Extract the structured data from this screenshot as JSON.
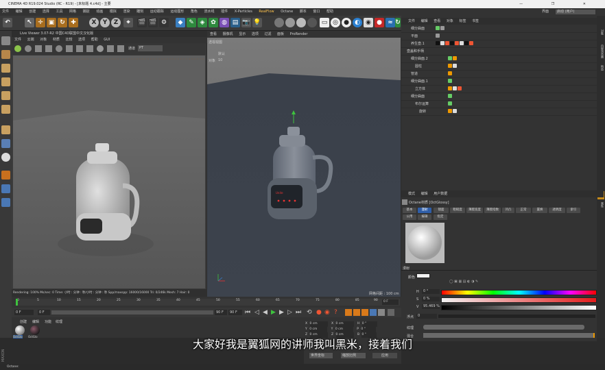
{
  "window": {
    "title": "CINEMA 4D R19.024 Studio (RC - R19) - [未标题 4.c4d] - 主要",
    "controls": [
      "—",
      "❐",
      "✕"
    ]
  },
  "menubar": {
    "items": [
      "文件",
      "编辑",
      "创建",
      "选择",
      "工具",
      "网格",
      "捕捉",
      "动画",
      "模拟",
      "渲染",
      "雕刻",
      "运动跟踪",
      "运动图形",
      "角色",
      "流水线",
      "插件",
      "X-Particles",
      "RealFlow",
      "Octane",
      "脚本",
      "窗口",
      "帮助"
    ],
    "layout_label": "界面",
    "layout_value": "启动 (用户)"
  },
  "live_viewer": {
    "title": "Live Viewer 3.07-R2 中国C4D联盟中文汉化版",
    "menu": [
      "文件",
      "云端",
      "对象",
      "材质",
      "比较",
      "选项",
      "帮助",
      "GUI"
    ],
    "tools_label": "通道",
    "channel_value": "PT",
    "status": "Rendering: 100%    Ms/sec: 0    Time: 小时 : 分钟 : 秒/小时 : 分钟 : 秒    Spp/maxspp: 16000/16000    Tri: 0/246k    Mesh: 7    Hair: 0"
  },
  "viewport": {
    "menu": [
      "查看",
      "摄像机",
      "显示",
      "选项",
      "过滤",
      "面板",
      "ProRender"
    ],
    "label": "透视视图",
    "hud_label": "默认",
    "hud_value": "10",
    "hud_field": "对象",
    "grid_label": "网格间距 : 100 cm"
  },
  "object_manager": {
    "menu": [
      "文件",
      "编辑",
      "查看",
      "对象",
      "标签",
      "书签"
    ],
    "objects": [
      {
        "name": "细分曲面",
        "indent": 0
      },
      {
        "name": "平面",
        "indent": 0
      },
      {
        "name": "养生壶.1",
        "indent": 0
      },
      {
        "name": "壶盖和手柄",
        "indent": 0
      },
      {
        "name": "细分曲面.2",
        "indent": 1
      },
      {
        "name": "圆柱",
        "indent": 2
      },
      {
        "name": "管道",
        "indent": 1
      },
      {
        "name": "细分曲面.1",
        "indent": 1
      },
      {
        "name": "立方体",
        "indent": 2
      },
      {
        "name": "细分曲面",
        "indent": 1
      },
      {
        "name": "布尔运算",
        "indent": 2
      },
      {
        "name": "旋转",
        "indent": 3
      }
    ]
  },
  "attribute_manager": {
    "menu": [
      "模式",
      "编辑",
      "用户数据"
    ],
    "material_name": "Octane材质 [OctGlossy]",
    "tabs_row1": [
      "基本",
      "漫射",
      "镜面",
      "粗糙度",
      "薄膜宽度",
      "薄膜指数",
      "凹凸",
      "正常",
      "置换",
      "透明度",
      "索引"
    ],
    "tabs_row2": [
      "公用",
      "编辑",
      "指定"
    ],
    "active_tab": "漫射",
    "section": "漫射",
    "color_label": "颜色",
    "h_label": "H",
    "h_value": "0 °",
    "s_label": "S",
    "s_value": "0 %",
    "v_label": "V",
    "v_value": "95.469 %",
    "float_label": "浮点",
    "float_value": "0",
    "texture_label": "纹理",
    "mix_label": "混合"
  },
  "timeline": {
    "ticks": [
      "0",
      "5",
      "10",
      "15",
      "20",
      "25",
      "30",
      "35",
      "40",
      "45",
      "50",
      "55",
      "60",
      "65",
      "70",
      "75",
      "80",
      "85",
      "90"
    ],
    "current_frame": "0 F",
    "start_field": "0 F",
    "start_field2": "0 F",
    "end_field": "90 F",
    "end_field2": "90 F"
  },
  "material_manager": {
    "menu": [
      "创建",
      "编辑",
      "功能",
      "纹理"
    ],
    "materials": [
      "OctGlo",
      "OctGlo"
    ]
  },
  "coordinates": {
    "rows": [
      [
        "X",
        "0 cm",
        "X",
        "0 cm",
        "H",
        "0 °"
      ],
      [
        "Y",
        "0 cm",
        "Y",
        "0 cm",
        "P",
        "0 °"
      ],
      [
        "Z",
        "0 cm",
        "Z",
        "0 cm",
        "B",
        "0 °"
      ]
    ],
    "mode_left": "世界坐标",
    "mode_right": "缩放比例",
    "apply": "应用"
  },
  "right_strip": [
    "对象",
    "内容浏览器",
    "构造",
    "层",
    "属性"
  ],
  "status_text": "Octane:",
  "subtitle": "大家好我是翼狐网的讲师我叫黑米，接着我们",
  "colors": {
    "accent": "#2f5ea8",
    "highlight": "#ffc34d",
    "viewport_bg": "#3d434b"
  }
}
